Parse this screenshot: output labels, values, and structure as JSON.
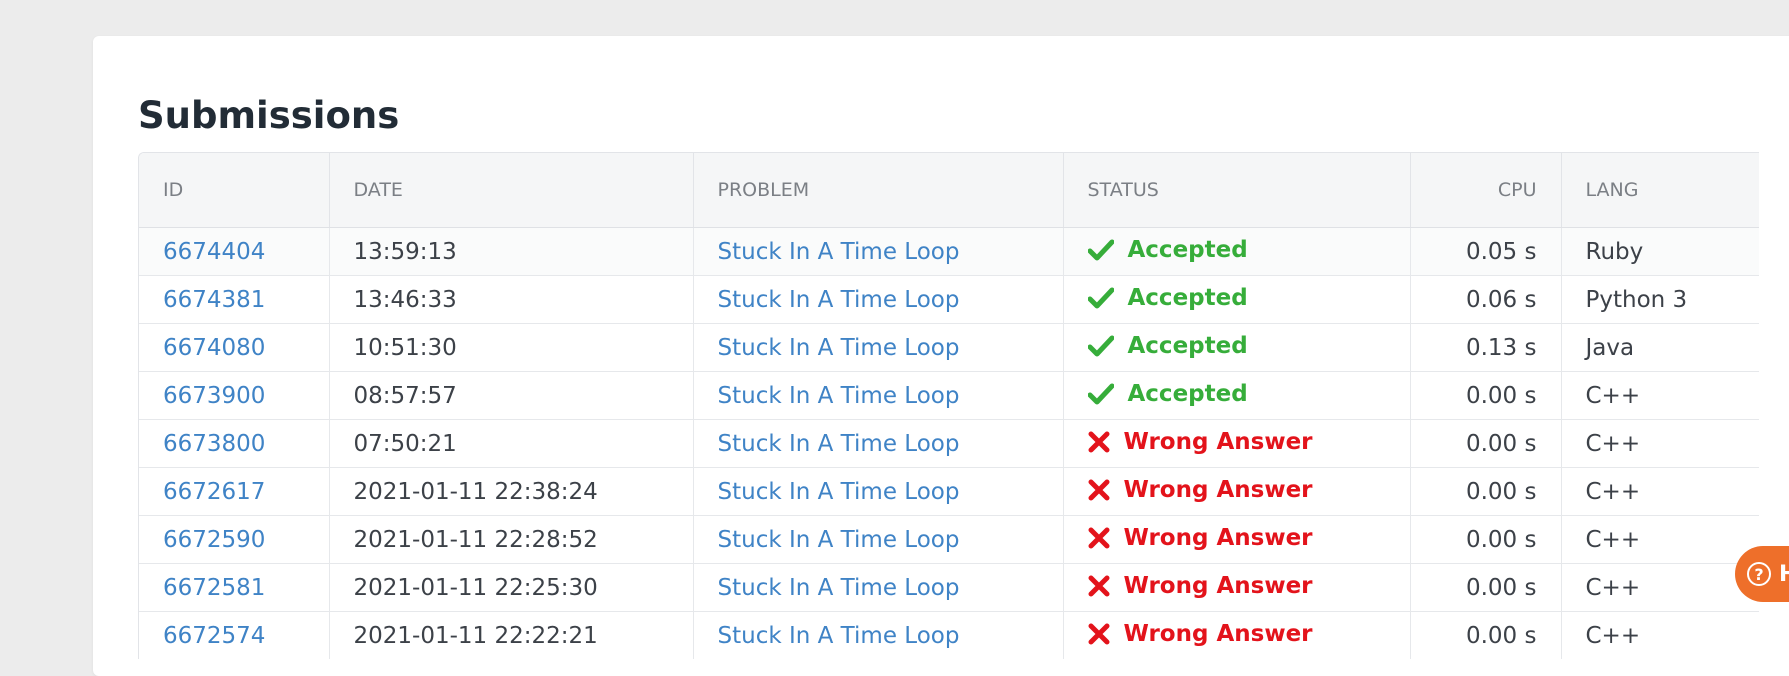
{
  "page": {
    "title": "Submissions"
  },
  "table": {
    "headers": {
      "id": "ID",
      "date": "DATE",
      "problem": "PROBLEM",
      "status": "STATUS",
      "cpu": "CPU",
      "lang": "LANG"
    },
    "rows": [
      {
        "id": "6674404",
        "date": "13:59:13",
        "problem": "Stuck In A Time Loop",
        "status": "Accepted",
        "ok": true,
        "cpu": "0.05 s",
        "lang": "Ruby"
      },
      {
        "id": "6674381",
        "date": "13:46:33",
        "problem": "Stuck In A Time Loop",
        "status": "Accepted",
        "ok": true,
        "cpu": "0.06 s",
        "lang": "Python 3"
      },
      {
        "id": "6674080",
        "date": "10:51:30",
        "problem": "Stuck In A Time Loop",
        "status": "Accepted",
        "ok": true,
        "cpu": "0.13 s",
        "lang": "Java"
      },
      {
        "id": "6673900",
        "date": "08:57:57",
        "problem": "Stuck In A Time Loop",
        "status": "Accepted",
        "ok": true,
        "cpu": "0.00 s",
        "lang": "C++"
      },
      {
        "id": "6673800",
        "date": "07:50:21",
        "problem": "Stuck In A Time Loop",
        "status": "Wrong Answer",
        "ok": false,
        "cpu": "0.00 s",
        "lang": "C++"
      },
      {
        "id": "6672617",
        "date": "2021-01-11 22:38:24",
        "problem": "Stuck In A Time Loop",
        "status": "Wrong Answer",
        "ok": false,
        "cpu": "0.00 s",
        "lang": "C++"
      },
      {
        "id": "6672590",
        "date": "2021-01-11 22:28:52",
        "problem": "Stuck In A Time Loop",
        "status": "Wrong Answer",
        "ok": false,
        "cpu": "0.00 s",
        "lang": "C++"
      },
      {
        "id": "6672581",
        "date": "2021-01-11 22:25:30",
        "problem": "Stuck In A Time Loop",
        "status": "Wrong Answer",
        "ok": false,
        "cpu": "0.00 s",
        "lang": "C++"
      },
      {
        "id": "6672574",
        "date": "2021-01-11 22:22:21",
        "problem": "Stuck In A Time Loop",
        "status": "Wrong Answer",
        "ok": false,
        "cpu": "0.00 s",
        "lang": "C++"
      }
    ]
  },
  "icons": {
    "accepted": "check-icon",
    "wrong": "cross-icon",
    "help": "help-circle-icon"
  },
  "colors": {
    "accepted": "#36ad3a",
    "wrong_answer": "#e3131b",
    "link": "#3f83c6",
    "help_button": "#ee6f2a"
  },
  "help": {
    "label": "H"
  }
}
